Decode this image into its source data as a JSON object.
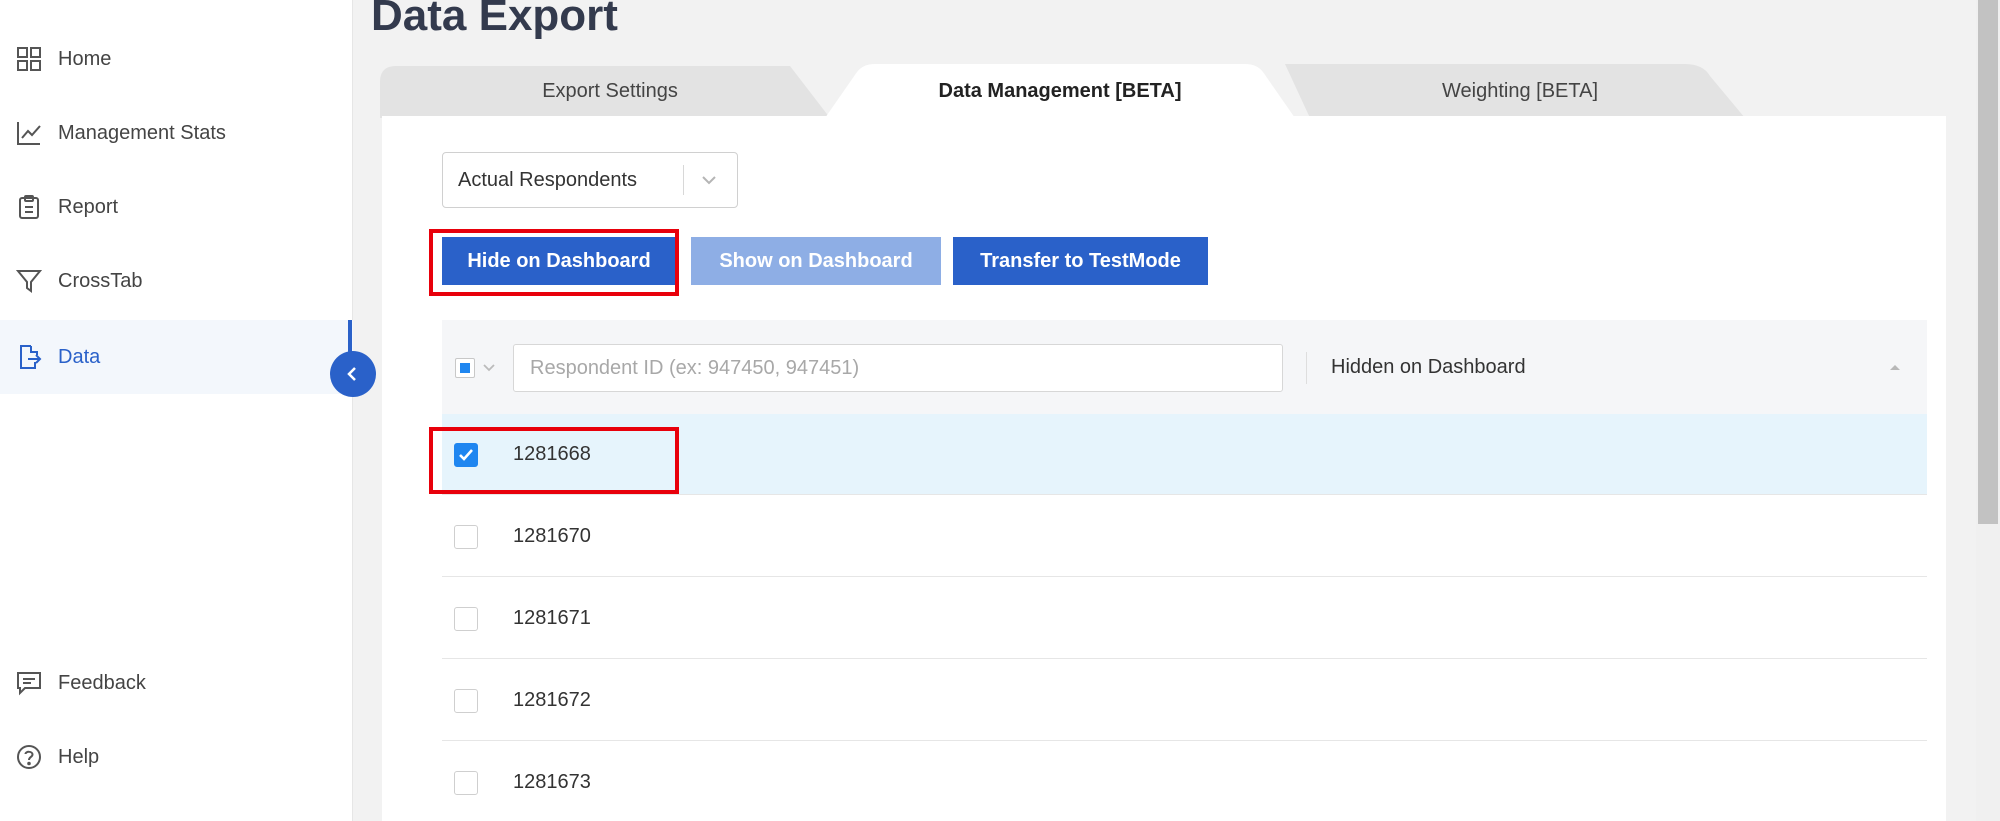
{
  "sidebar": {
    "items": [
      {
        "label": "Home",
        "icon": "grid-icon"
      },
      {
        "label": "Management Stats",
        "icon": "line-chart-icon"
      },
      {
        "label": "Report",
        "icon": "clipboard-icon"
      },
      {
        "label": "CrossTab",
        "icon": "filter-icon"
      },
      {
        "label": "Data",
        "icon": "file-export-icon",
        "active": true
      }
    ],
    "bottom_items": [
      {
        "label": "Feedback",
        "icon": "feedback-icon"
      },
      {
        "label": "Help",
        "icon": "help-circle-icon"
      }
    ]
  },
  "page": {
    "title": "Data Export"
  },
  "tabs": [
    {
      "label": "Export Settings",
      "active": false
    },
    {
      "label": "Data Management [BETA]",
      "active": true
    },
    {
      "label": "Weighting [BETA]",
      "active": false
    }
  ],
  "respondent_select": {
    "value": "Actual Respondents"
  },
  "actions": {
    "hide_label": "Hide on Dashboard",
    "show_label": "Show on Dashboard",
    "transfer_label": "Transfer to TestMode"
  },
  "filter": {
    "placeholder": "Respondent ID (ex: 947450, 947451)",
    "column_label": "Hidden on Dashboard"
  },
  "rows": [
    {
      "id": "1281668",
      "checked": true
    },
    {
      "id": "1281670",
      "checked": false
    },
    {
      "id": "1281671",
      "checked": false
    },
    {
      "id": "1281672",
      "checked": false
    },
    {
      "id": "1281673",
      "checked": false
    }
  ],
  "colors": {
    "primary": "#2a61c9",
    "primary_disabled": "#8eaee5",
    "highlight": "#e8000b",
    "checkbox": "#1f86f0",
    "selected_row": "#e6f4fc"
  }
}
